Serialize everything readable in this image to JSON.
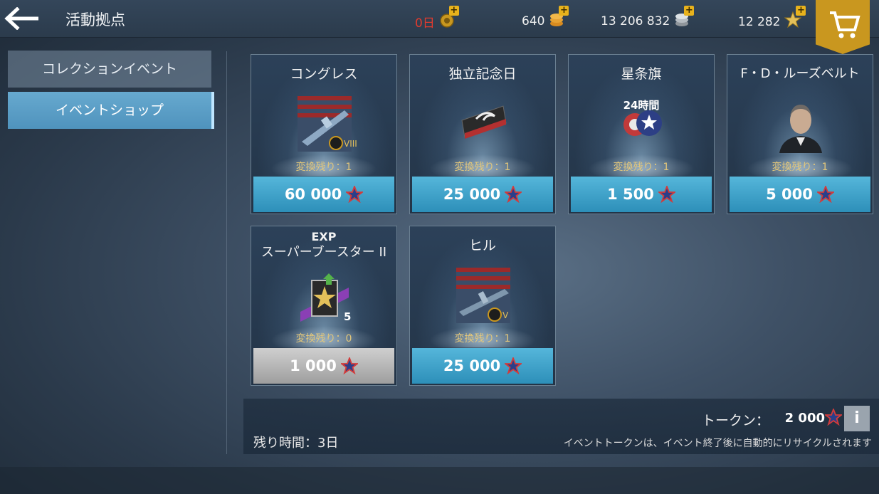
{
  "header": {
    "title": "活動拠点",
    "resources": [
      {
        "name": "premium-days",
        "value": "0日",
        "color": "#e23b2e",
        "icon": "premium-medal-icon"
      },
      {
        "name": "doubloons",
        "value": "640",
        "color": "#f0f0f0",
        "icon": "gold-coins-icon"
      },
      {
        "name": "credits",
        "value": "13 206 832",
        "color": "#f0f0f0",
        "icon": "silver-coins-icon"
      },
      {
        "name": "free-xp",
        "value": "12 282",
        "color": "#f0f0f0",
        "icon": "gold-star-icon"
      }
    ]
  },
  "sidebar": {
    "items": [
      {
        "label": "コレクションイベント",
        "active": false
      },
      {
        "label": "イベントショップ",
        "active": true
      }
    ]
  },
  "shop": {
    "items": [
      {
        "name": "コングレス",
        "remaining": "変換残り：1",
        "price": "60 000",
        "disabled": false,
        "tier": "VIII"
      },
      {
        "name": "独立記念日",
        "remaining": "変換残り：1",
        "price": "25 000",
        "disabled": false
      },
      {
        "name": "星条旗",
        "badge": "24時間",
        "remaining": "変換残り：1",
        "price": "1 500",
        "disabled": false
      },
      {
        "name": "F・D・ルーズベルト",
        "remaining": "変換残り：1",
        "price": "5 000",
        "disabled": false
      },
      {
        "name_line1": "EXP",
        "name_line2": "スーパーブースター II",
        "count": "5",
        "remaining": "変換残り：0",
        "price": "1 000",
        "disabled": true
      },
      {
        "name": "ヒル",
        "remaining": "変換残り：1",
        "price": "25 000",
        "disabled": false,
        "tier": "V"
      }
    ]
  },
  "footer": {
    "token_label": "トークン：",
    "token_value": "2 000",
    "info_label": "i",
    "time_left": "残り時間：3日",
    "notice": "イベントトークンは、イベント終了後に自動的にリサイクルされます"
  },
  "colors": {
    "accent": "#4f93bd",
    "gold": "#c9971f",
    "remain_text": "#e3c77a"
  }
}
